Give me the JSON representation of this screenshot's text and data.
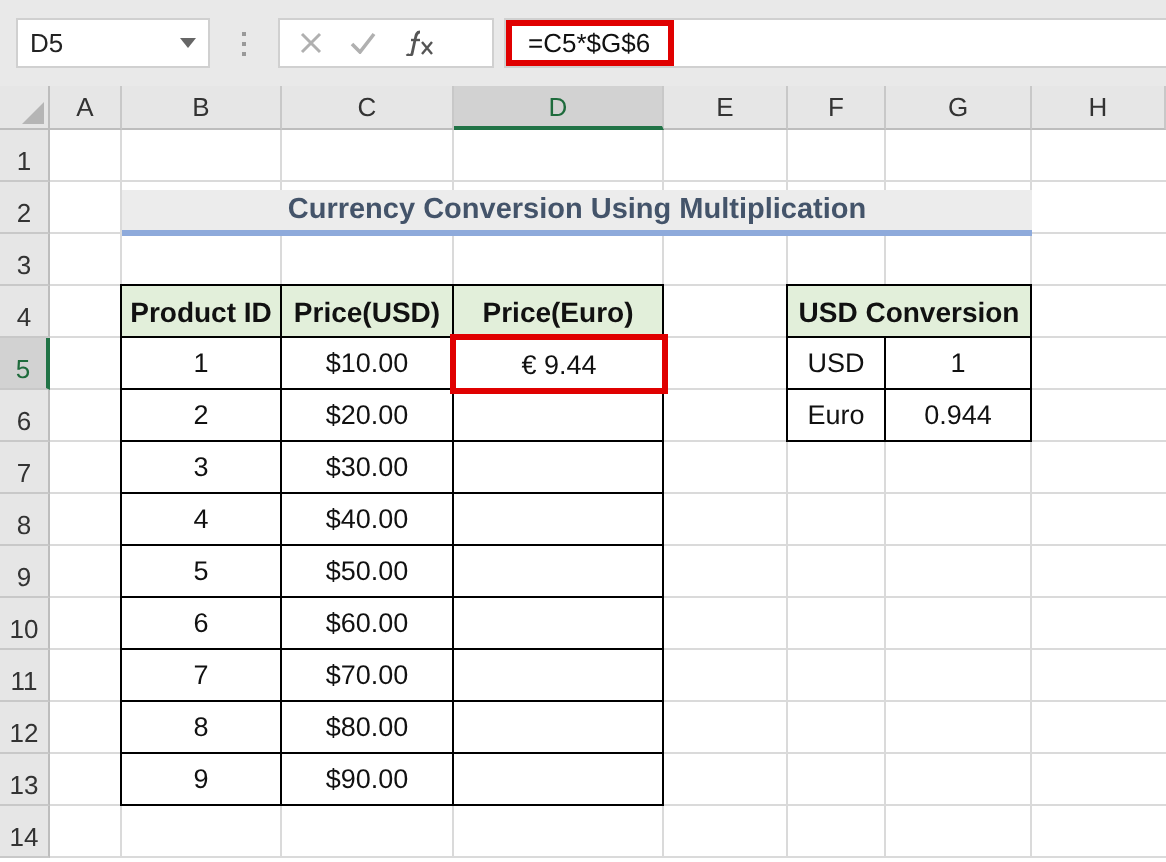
{
  "formula_bar": {
    "name_box": "D5",
    "formula": "=C5*$G$6"
  },
  "column_headers": [
    {
      "label": "A",
      "selected": false
    },
    {
      "label": "B",
      "selected": false
    },
    {
      "label": "C",
      "selected": false
    },
    {
      "label": "D",
      "selected": true
    },
    {
      "label": "E",
      "selected": false
    },
    {
      "label": "F",
      "selected": false
    },
    {
      "label": "G",
      "selected": false
    },
    {
      "label": "H",
      "selected": false
    }
  ],
  "row_headers": [
    {
      "label": "1",
      "selected": false
    },
    {
      "label": "2",
      "selected": false
    },
    {
      "label": "3",
      "selected": false
    },
    {
      "label": "4",
      "selected": false
    },
    {
      "label": "5",
      "selected": true
    },
    {
      "label": "6",
      "selected": false
    },
    {
      "label": "7",
      "selected": false
    },
    {
      "label": "8",
      "selected": false
    },
    {
      "label": "9",
      "selected": false
    },
    {
      "label": "10",
      "selected": false
    },
    {
      "label": "11",
      "selected": false
    },
    {
      "label": "12",
      "selected": false
    },
    {
      "label": "13",
      "selected": false
    },
    {
      "label": "14",
      "selected": false
    }
  ],
  "title": "Currency Conversion Using Multiplication",
  "price_table": {
    "columns": [
      "Product ID",
      "Price(USD)",
      "Price(Euro)"
    ],
    "rows": [
      {
        "product_id": "1",
        "price_usd": "$10.00",
        "price_euro": "€ 9.44",
        "selected": true
      },
      {
        "product_id": "2",
        "price_usd": "$20.00",
        "selected": false
      },
      {
        "product_id": "3",
        "price_usd": "$30.00",
        "selected": false
      },
      {
        "product_id": "4",
        "price_usd": "$40.00",
        "selected": false
      },
      {
        "product_id": "5",
        "price_usd": "$50.00",
        "selected": false
      },
      {
        "product_id": "6",
        "price_usd": "$60.00",
        "selected": false
      },
      {
        "product_id": "7",
        "price_usd": "$70.00",
        "selected": false
      },
      {
        "product_id": "8",
        "price_usd": "$80.00",
        "selected": false
      },
      {
        "product_id": "9",
        "price_usd": "$90.00",
        "selected": false
      }
    ]
  },
  "conversion_table": {
    "title": "USD Conversion",
    "rows": [
      {
        "currency": "USD",
        "rate": "1"
      },
      {
        "currency": "Euro",
        "rate": "0.944"
      }
    ]
  }
}
